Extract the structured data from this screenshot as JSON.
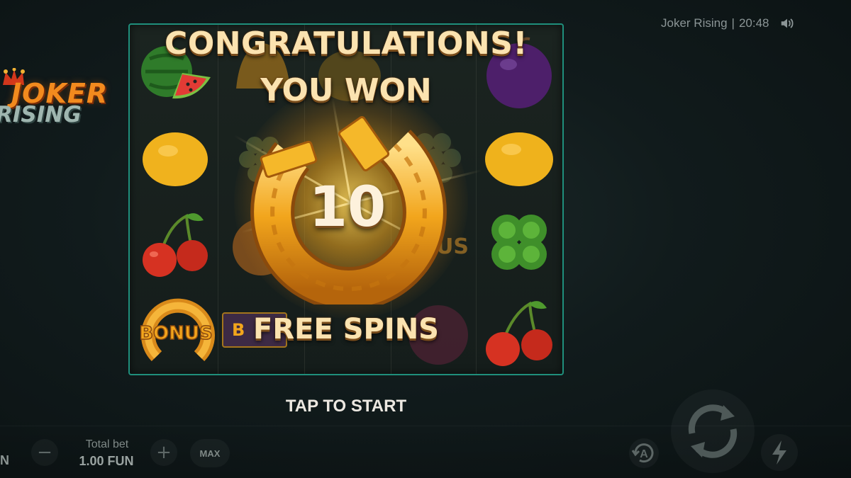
{
  "status": {
    "game_title": "Joker Rising",
    "separator": "|",
    "time": "20:48"
  },
  "logo": {
    "line1": "JOKER",
    "line2": "RISING"
  },
  "win_popup": {
    "headline": "CONGRATULATIONS!",
    "subheadline": "YOU WON",
    "count": "10",
    "prize": "FREE SPINS",
    "prompt": "TAP TO START"
  },
  "reels": {
    "bonus_label": "BONUS",
    "bonus_partial": "B",
    "bonus_faded": "US"
  },
  "bottom_bar": {
    "left_fragment": "N",
    "minus": "−",
    "plus": "+",
    "total_bet_label": "Total bet",
    "total_bet_value": "1.00 FUN",
    "max_label": "MAX",
    "auto_label": "A"
  },
  "colors": {
    "reel_border": "#1f8f7c",
    "headline": "#fbe3b0",
    "gold": "#f2a51c",
    "background": "#111b1c"
  },
  "icons": [
    "speaker-icon",
    "joker-hat-icon",
    "horseshoe-icon",
    "autoplay-icon",
    "spin-arrows-icon",
    "lightning-icon"
  ]
}
